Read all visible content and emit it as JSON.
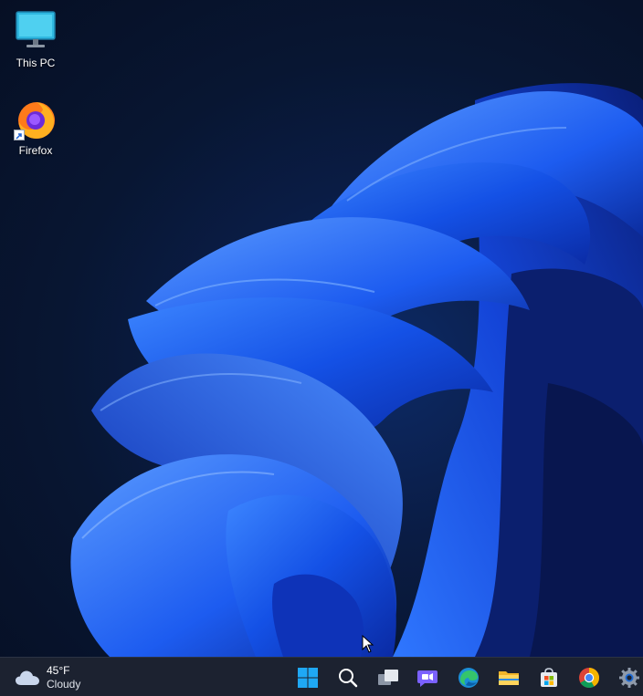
{
  "desktop": {
    "icons": [
      {
        "label": "This PC",
        "icon": "monitor-icon"
      },
      {
        "label": "Firefox",
        "icon": "firefox-icon"
      }
    ],
    "wallpaper": "windows-11-bloom"
  },
  "taskbar": {
    "weather": {
      "temperature": "45°F",
      "condition": "Cloudy",
      "icon": "cloud-icon"
    },
    "buttons": [
      {
        "name": "start",
        "icon": "windows-start-icon"
      },
      {
        "name": "search",
        "icon": "search-icon"
      },
      {
        "name": "task-view",
        "icon": "task-view-icon"
      },
      {
        "name": "chat",
        "icon": "teams-chat-icon"
      },
      {
        "name": "edge",
        "icon": "edge-icon"
      },
      {
        "name": "file-explorer",
        "icon": "folder-icon"
      },
      {
        "name": "microsoft-store",
        "icon": "store-icon"
      },
      {
        "name": "chrome",
        "icon": "chrome-icon"
      },
      {
        "name": "settings",
        "icon": "gear-icon"
      }
    ]
  },
  "colors": {
    "accent": "#1f6bff",
    "taskbar_bg": "#1c2230",
    "desktop_bg": "#081632"
  }
}
